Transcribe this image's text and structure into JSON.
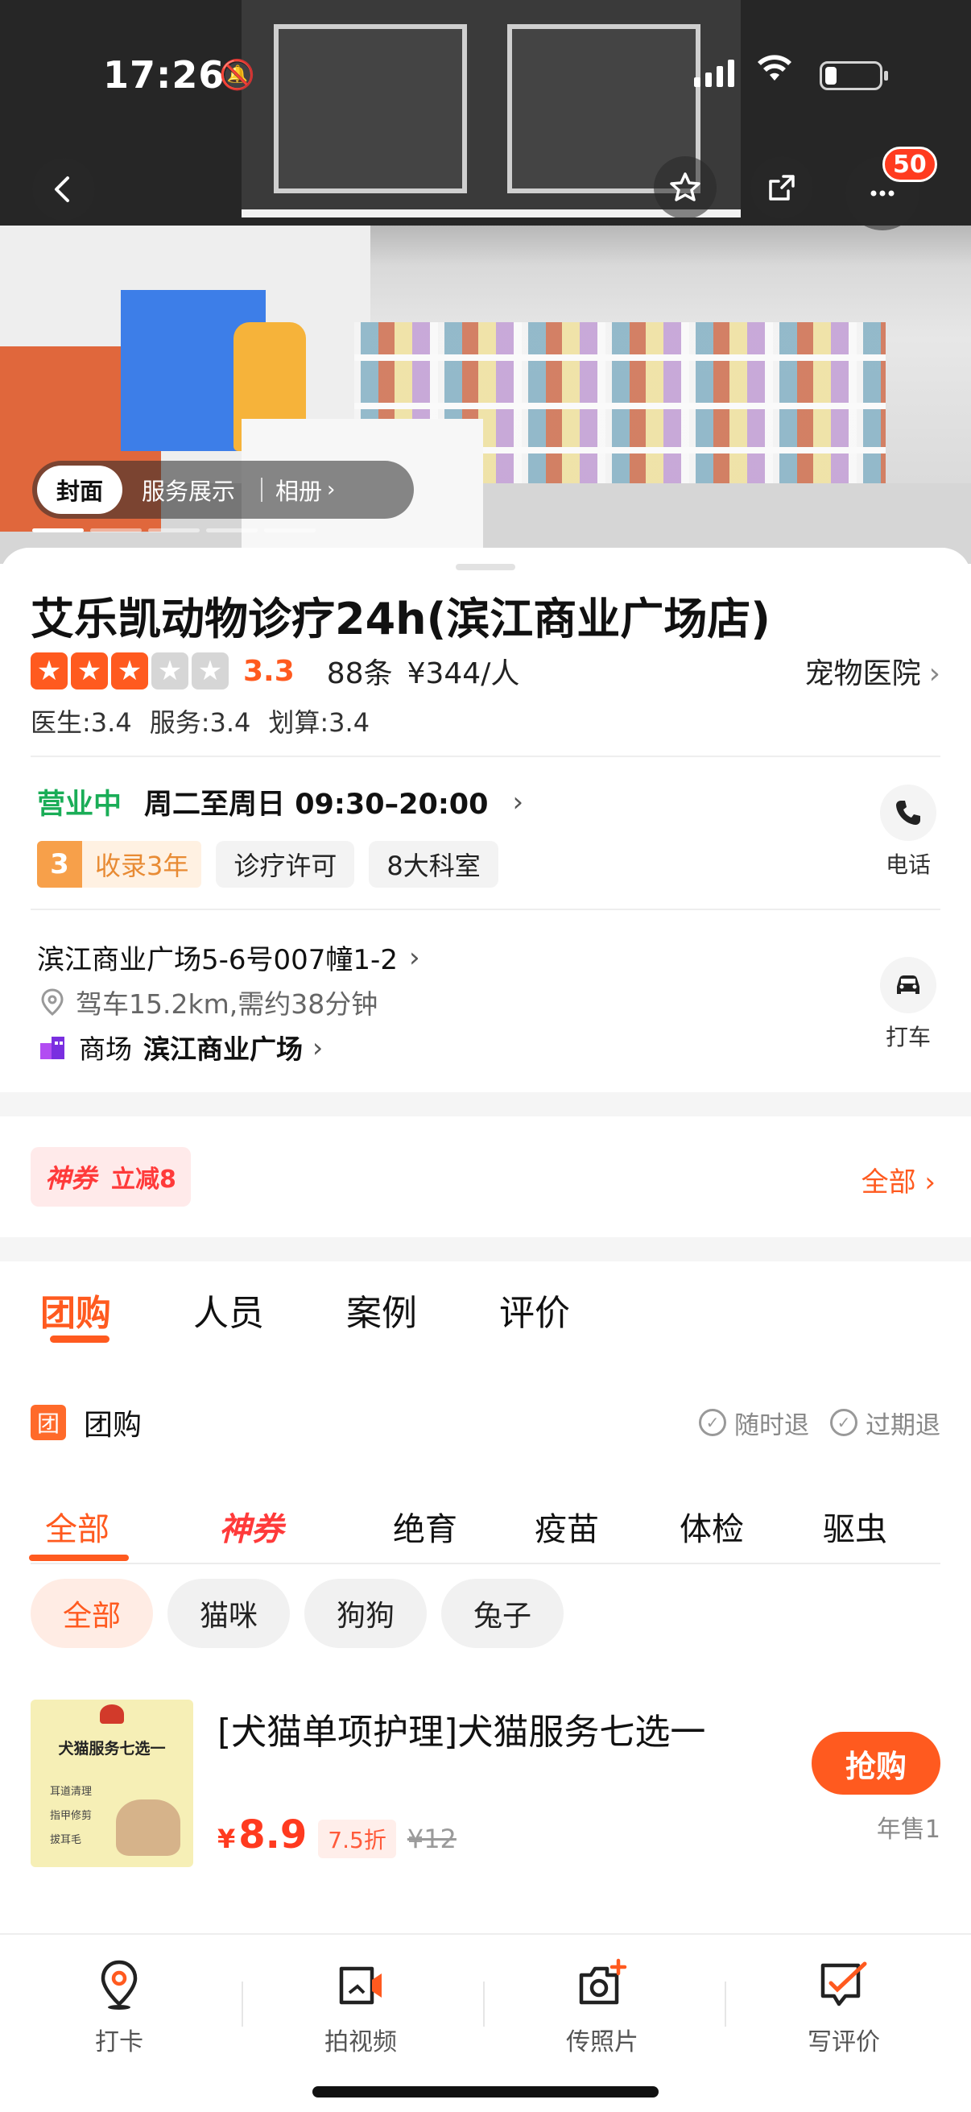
{
  "status_bar": {
    "time": "17:26"
  },
  "hero": {
    "more_badge": "50",
    "tabs": [
      {
        "label": "封面"
      },
      {
        "label": "服务展示"
      },
      {
        "label": "相册"
      }
    ]
  },
  "shop": {
    "name": "艾乐凯动物诊疗24h(滨江商业广场店)",
    "rating_stars": 3,
    "score": "3.3",
    "review_count": "88条",
    "avg_price": "¥344/人",
    "category": "宠物医院",
    "subscores": [
      "医生:3.4",
      "服务:3.4",
      "划算:3.4"
    ],
    "status": "营业中",
    "hours": "周二至周日 09:30–20:00",
    "years_num": "3",
    "years_label": "收录3年",
    "tags": [
      "诊疗许可",
      "8大科室"
    ],
    "phone_label": "电话",
    "address": "滨江商业广场5-6号007幢1-2",
    "distance": "驾车15.2km,需约38分钟",
    "mall_prefix": "商场",
    "mall_name": "滨江商业广场",
    "taxi_label": "打车"
  },
  "coupon": {
    "brand": "神券",
    "deal": "立减8",
    "all_label": "全部"
  },
  "main_tabs": [
    "团购",
    "人员",
    "案例",
    "评价"
  ],
  "group": {
    "title": "团购",
    "icon_char": "团",
    "guarantees": [
      "随时退",
      "过期退"
    ]
  },
  "category_tabs": [
    "全部",
    "神券",
    "绝育",
    "疫苗",
    "体检",
    "驱虫"
  ],
  "pet_chips": [
    "全部",
    "猫咪",
    "狗狗",
    "兔子"
  ],
  "deal": {
    "title": "[犬猫单项护理]犬猫服务七选一",
    "thumb_title": "犬猫服务七选一",
    "thumb_lines": [
      "耳道清理",
      "指甲修剪",
      "拔耳毛"
    ],
    "currency": "¥",
    "price": "8.9",
    "discount": "7.5折",
    "original": "¥12",
    "buy_label": "抢购",
    "sold": "年售1"
  },
  "bottom_bar": [
    "打卡",
    "拍视频",
    "传照片",
    "写评价"
  ],
  "colors": {
    "accent": "#ff5a1f",
    "open_green": "#1aad57",
    "coupon_red": "#ff3a3a"
  }
}
